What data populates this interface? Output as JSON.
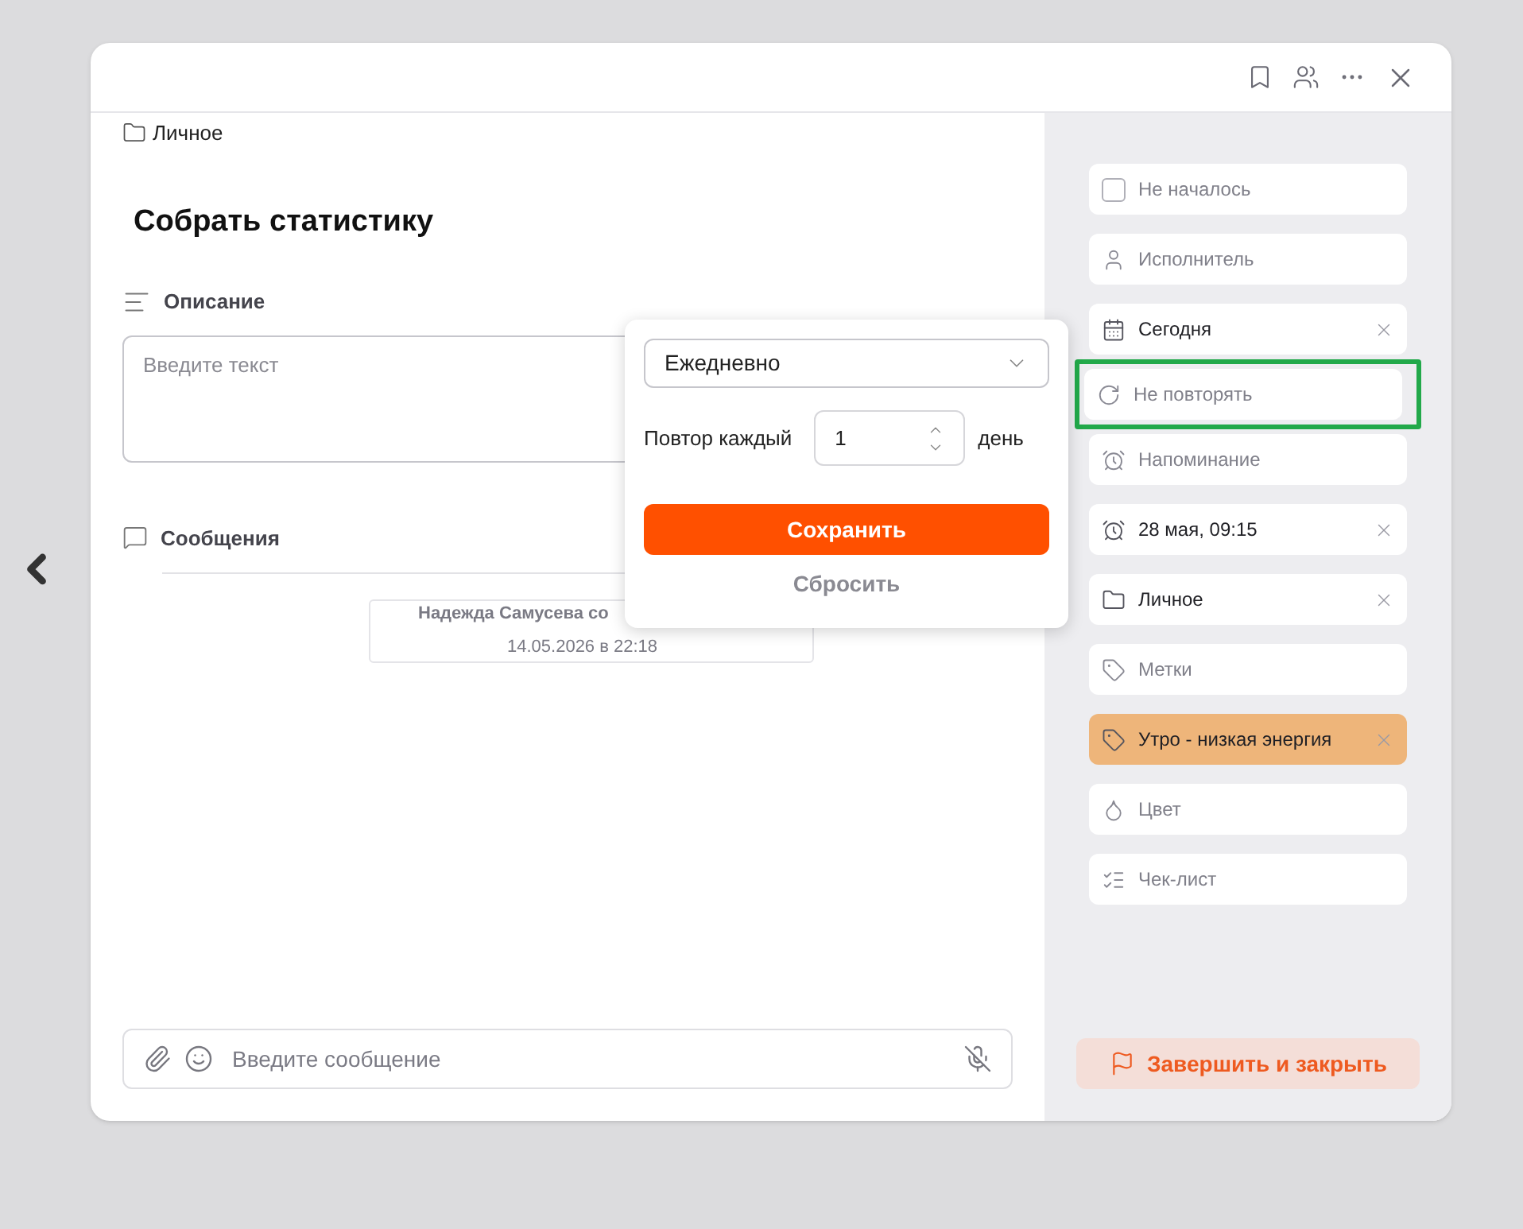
{
  "breadcrumb": "Личное",
  "title": "Собрать статистику",
  "description": {
    "label": "Описание",
    "placeholder": "Введите текст"
  },
  "messages": {
    "label": "Сообщения",
    "card": {
      "author": "Надежда Самусева со",
      "time": "14.05.2026 в 22:18"
    }
  },
  "composer": {
    "placeholder": "Введите сообщение"
  },
  "repeat_popover": {
    "frequency": "Ежедневно",
    "every_label": "Повтор каждый",
    "every_value": "1",
    "unit": "день",
    "save": "Сохранить",
    "reset": "Сбросить"
  },
  "sidebar": {
    "items": [
      {
        "kind": "status",
        "label": "Не началось",
        "filled": false,
        "clearable": false,
        "highlighted": false,
        "checked": false
      },
      {
        "kind": "person",
        "label": "Исполнитель",
        "filled": false,
        "clearable": false,
        "highlighted": false
      },
      {
        "kind": "calendar",
        "label": "Сегодня",
        "filled": true,
        "clearable": true,
        "highlighted": false
      },
      {
        "kind": "repeat",
        "label": "Не повторять",
        "filled": false,
        "clearable": false,
        "highlighted": true
      },
      {
        "kind": "alarm",
        "label": "Напоминание",
        "filled": false,
        "clearable": false,
        "highlighted": false
      },
      {
        "kind": "alarm",
        "label": "28 мая, 09:15",
        "filled": true,
        "clearable": true,
        "highlighted": false
      },
      {
        "kind": "folder",
        "label": "Личное",
        "filled": true,
        "clearable": true,
        "highlighted": false
      },
      {
        "kind": "tag",
        "label": "Метки",
        "filled": false,
        "clearable": false,
        "highlighted": false
      },
      {
        "kind": "tag",
        "label": "Утро - низкая энергия",
        "filled": true,
        "clearable": true,
        "highlighted": false,
        "color": "#eeb57a"
      },
      {
        "kind": "drop",
        "label": "Цвет",
        "filled": false,
        "clearable": false,
        "highlighted": false
      },
      {
        "kind": "checklist",
        "label": "Чек-лист",
        "filled": false,
        "clearable": false,
        "highlighted": false
      }
    ],
    "finish": "Завершить и закрыть"
  }
}
